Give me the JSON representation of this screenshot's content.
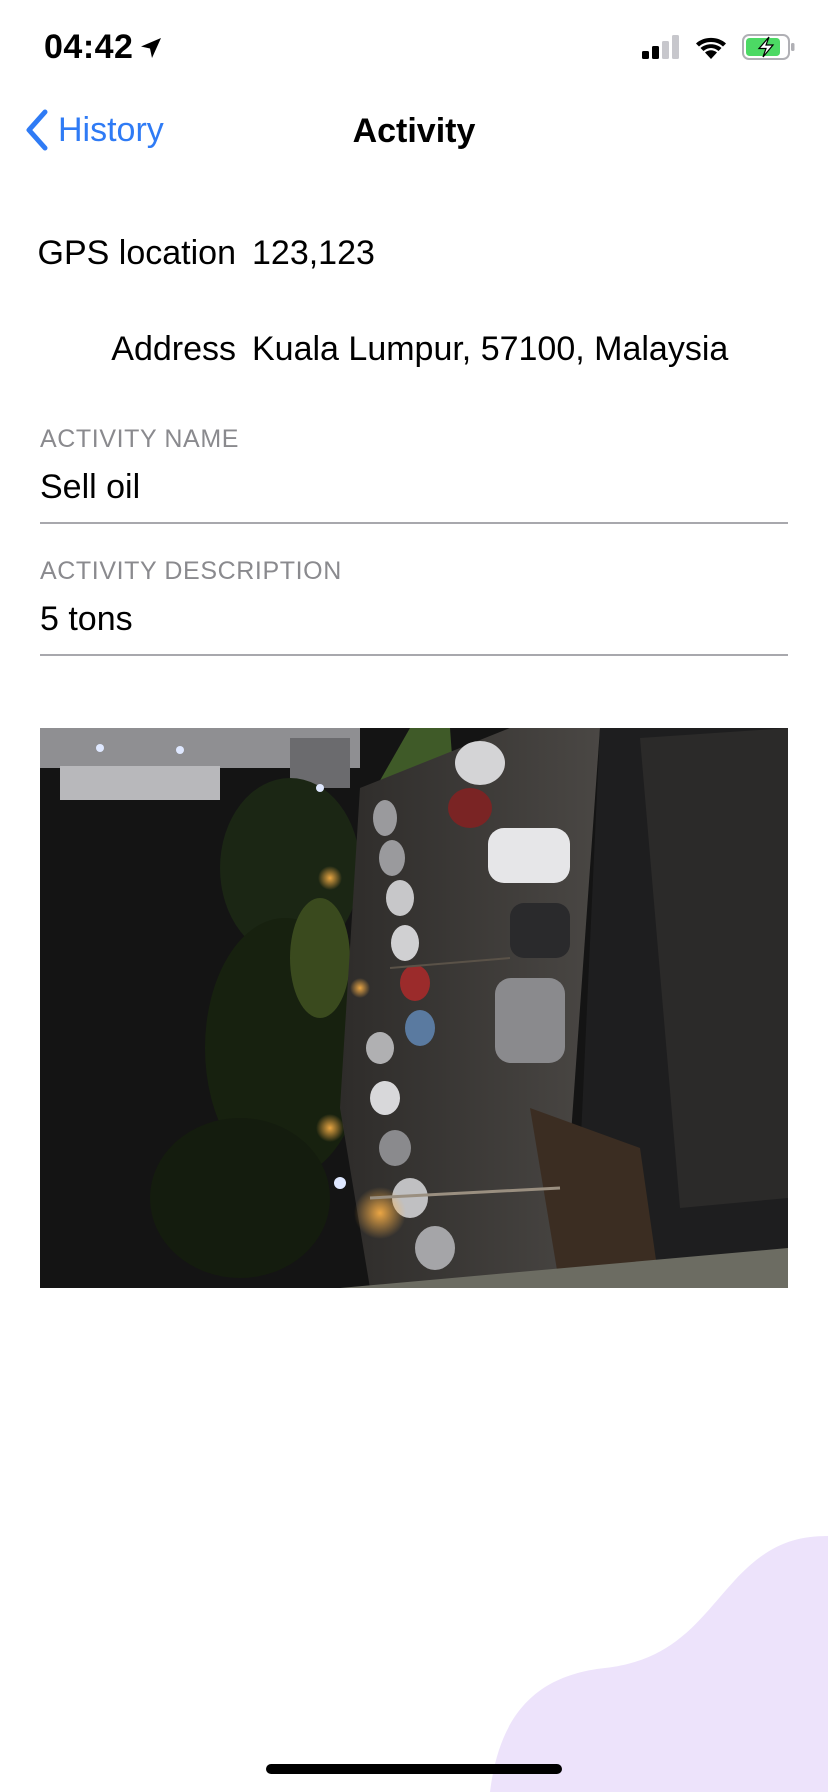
{
  "status_bar": {
    "time": "04:42",
    "icons": [
      "location-arrow-icon",
      "signal-icon",
      "wifi-icon",
      "battery-charging-icon"
    ],
    "battery_color": "#4cd964"
  },
  "nav": {
    "back_label": "History",
    "back_icon": "chevron-left-icon",
    "title": "Activity",
    "accent_color": "#2f7bf5"
  },
  "info": {
    "gps_label": "GPS location",
    "gps_value": "123,123",
    "address_label": "Address",
    "address_value": "Kuala Lumpur, 57100, Malaysia"
  },
  "fields": {
    "activity_name_label": "ACTIVITY NAME",
    "activity_name_value": "Sell oil",
    "activity_description_label": "ACTIVITY DESCRIPTION",
    "activity_description_value": "5 tons"
  },
  "photo": {
    "subject": "night-parking-lot-photo"
  },
  "decoration": {
    "blob_color": "#ede3fb"
  }
}
